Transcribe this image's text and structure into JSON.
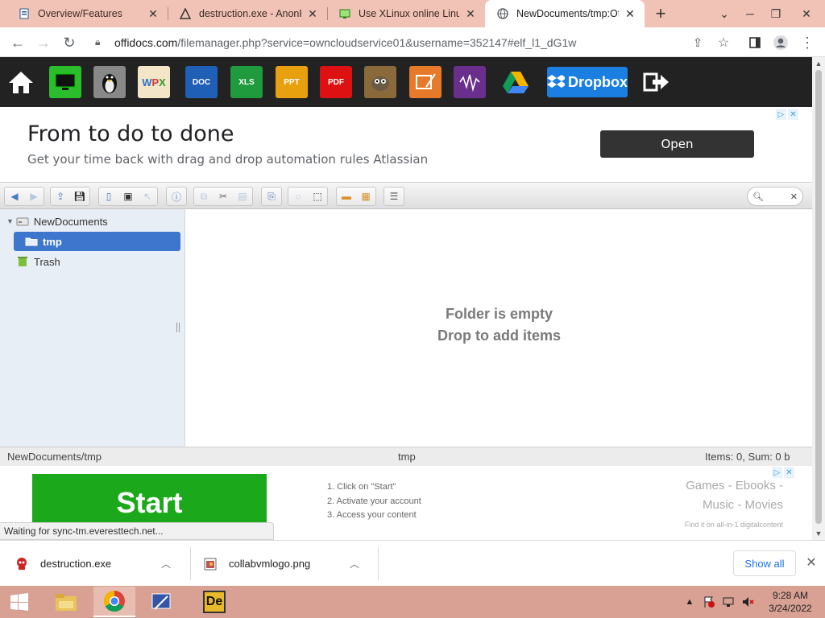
{
  "browser": {
    "tabs": [
      {
        "title": "Overview/Features",
        "icon": "doc-icon"
      },
      {
        "title": "destruction.exe - AnonFiles",
        "icon": "anonfiles-icon"
      },
      {
        "title": "Use XLinux online Linux",
        "icon": "xlinux-icon"
      },
      {
        "title": "NewDocuments/tmp:Offi",
        "icon": "globe-icon"
      }
    ],
    "new_tab": "+",
    "url_main": "offidocs.com",
    "url_tail": "/filemanager.php?service=owncloudservice01&username=352147#elf_l1_dG1w"
  },
  "appbar": {
    "apps": [
      "Home",
      "Desktop",
      "Linux",
      "WPS",
      "DOC",
      "XLS",
      "PPT",
      "PDF",
      "GIMP",
      "Video",
      "Audio",
      "Drive",
      "Dropbox",
      "Logout"
    ],
    "dropbox_label": "Dropbox"
  },
  "ad_top": {
    "headline": "From to do to done",
    "subtext": "Get your time back with drag and drop automation rules Atlassian",
    "cta": "Open"
  },
  "filemanager": {
    "tree": {
      "root": "NewDocuments",
      "selected": "tmp",
      "trash": "Trash"
    },
    "empty_line1": "Folder is empty",
    "empty_line2": "Drop to add items",
    "status_path": "NewDocuments/tmp",
    "status_center": "tmp",
    "status_items": "Items: 0, Sum: 0 b"
  },
  "ad_bottom": {
    "start": "Start",
    "steps": [
      "1. Click on \"Start\"",
      "2. Activate your account",
      "3. Access your content"
    ],
    "right_line1": "Games - Ebooks -",
    "right_line2": "Music - Movies",
    "right_small": "Find it on all-in-1 digitalcontent"
  },
  "loading_status": "Waiting for sync-tm.everesttech.net...",
  "downloads": {
    "items": [
      {
        "name": "destruction.exe"
      },
      {
        "name": "collabvmlogo.png"
      }
    ],
    "show_all": "Show all"
  },
  "taskbar": {
    "time": "9:28 AM",
    "date": "3/24/2022"
  }
}
